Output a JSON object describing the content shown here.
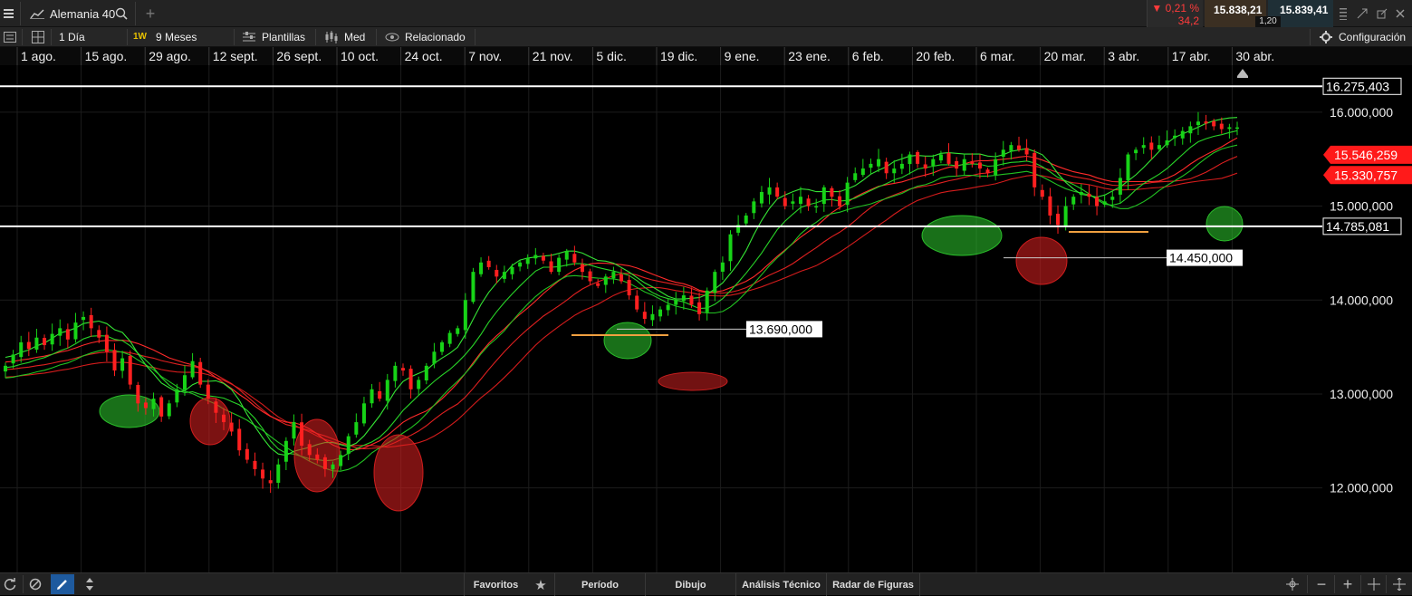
{
  "header": {
    "instrument": "Alemania 40",
    "change_pct": "▼ 0,21 %",
    "change_pts": "34,2",
    "bid": "15.838,21",
    "ask": "15.839,41",
    "spread": "1,20"
  },
  "toolbar": {
    "interval": "1 Día",
    "range_badge": "1W",
    "range": "9 Meses",
    "templates": "Plantillas",
    "price_type": "Med",
    "related": "Relacionado",
    "settings": "Configuración"
  },
  "bottom": {
    "favorites": "Favoritos",
    "period": "Período",
    "drawing": "Dibujo",
    "technical": "Análisis Técnico",
    "patterns": "Radar de Figuras"
  },
  "colors": {
    "up": "#17d317",
    "down": "#ff2020",
    "price_tag": "#ff1a1a",
    "accent": "#e8c200"
  },
  "icons": [
    "menu-icon",
    "chart-line-icon",
    "search-icon",
    "plus-icon",
    "grid-icon",
    "layers-icon",
    "candles-icon",
    "eye-icon",
    "gear-icon",
    "refresh-icon",
    "cancel-icon",
    "pencil-icon",
    "arrows-icon",
    "star-icon",
    "crosshair-icon",
    "minus-icon"
  ],
  "chart_data": {
    "type": "candlestick",
    "x_ticks": [
      "1 ago.",
      "15 ago.",
      "29 ago.",
      "12 sept.",
      "26 sept.",
      "10 oct.",
      "24 oct.",
      "7 nov.",
      "21 nov.",
      "5 dic.",
      "19 dic.",
      "9 ene.",
      "23 ene.",
      "6 feb.",
      "20 feb.",
      "6 mar.",
      "20 mar.",
      "3 abr.",
      "17 abr.",
      "30 abr."
    ],
    "y_ticks": [
      "16.000,000",
      "15.000,000",
      "14.000,000",
      "13.000,000",
      "12.000,000"
    ],
    "ylim": [
      11100,
      16500
    ],
    "levels": [
      {
        "value": 16275.403,
        "label": "16.275,403",
        "color": "#ffffff"
      },
      {
        "value": 14785.081,
        "label": "14.785,081",
        "color": "#ffffff"
      }
    ],
    "annotations": [
      {
        "value": 14450,
        "label": "14.450,000"
      },
      {
        "value": 13690,
        "label": "13.690,000"
      }
    ],
    "price_tags": [
      {
        "value": 15546.259,
        "label": "15.546,259"
      },
      {
        "value": 15330.757,
        "label": "15.330,757"
      }
    ],
    "closes": [
      13300,
      13420,
      13550,
      13480,
      13600,
      13520,
      13640,
      13700,
      13580,
      13760,
      13820,
      13700,
      13600,
      13450,
      13250,
      13380,
      13100,
      12900,
      12850,
      12950,
      12760,
      12900,
      13050,
      13200,
      13350,
      13100,
      12950,
      12800,
      12700,
      12600,
      12400,
      12300,
      12200,
      12100,
      12050,
      12250,
      12500,
      12700,
      12450,
      12350,
      12300,
      12200,
      12250,
      12350,
      12550,
      12700,
      12900,
      13050,
      12950,
      13150,
      13300,
      13250,
      13050,
      13150,
      13300,
      13450,
      13550,
      13650,
      13700,
      14000,
      14300,
      14400,
      14350,
      14250,
      14300,
      14350,
      14400,
      14450,
      14480,
      14420,
      14300,
      14450,
      14520,
      14400,
      14300,
      14200,
      14150,
      14250,
      14300,
      14200,
      14050,
      13900,
      13800,
      13850,
      13900,
      13950,
      14000,
      14050,
      13950,
      13850,
      14100,
      14300,
      14400,
      14700,
      14800,
      14900,
      15050,
      15150,
      15200,
      15100,
      15000,
      15050,
      15100,
      15000,
      15000,
      15200,
      15100,
      15000,
      15250,
      15350,
      15400,
      15450,
      15500,
      15350,
      15400,
      15450,
      15550,
      15450,
      15400,
      15500,
      15550,
      15450,
      15400,
      15500,
      15450,
      15400,
      15350,
      15500,
      15600,
      15650,
      15600,
      15550,
      15200,
      15100,
      14900,
      14800,
      15000,
      15100,
      15150,
      15100,
      15000,
      15050,
      15100,
      15300,
      15550,
      15600,
      15650,
      15600,
      15650,
      15700,
      15750,
      15800,
      15850,
      15900,
      15880,
      15850,
      15820,
      15840,
      15838
    ]
  }
}
